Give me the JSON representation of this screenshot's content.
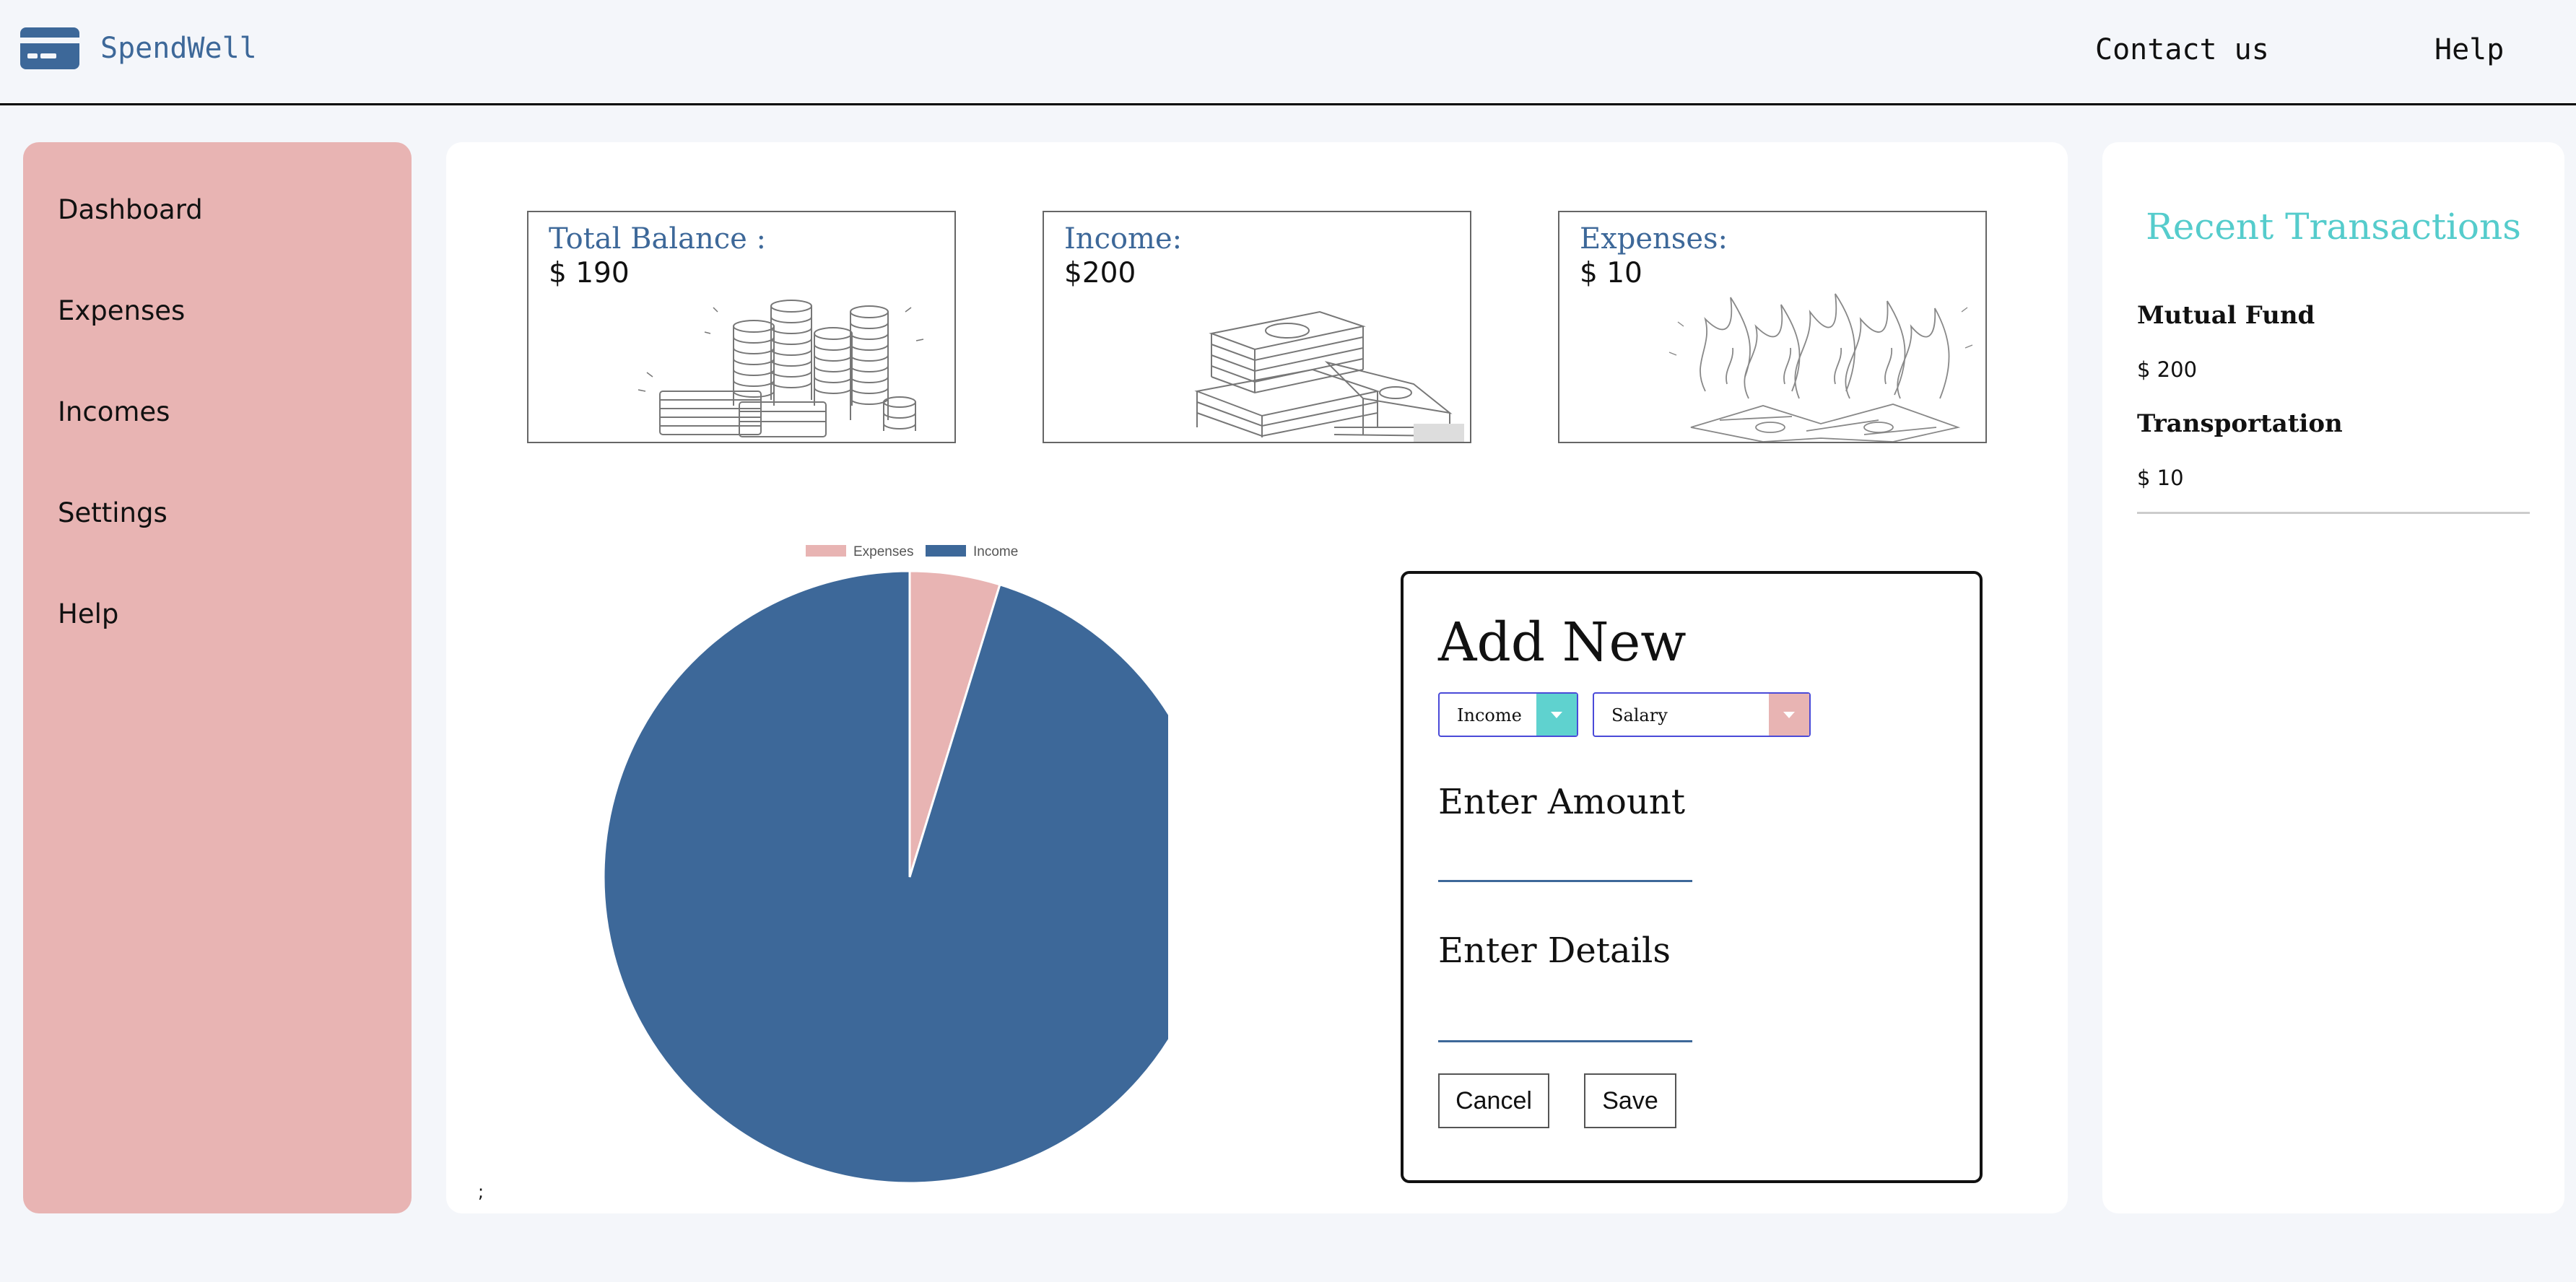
{
  "header": {
    "brand": "SpendWell",
    "logo_icon": "credit-card-icon",
    "nav": [
      {
        "label": "Contact us"
      },
      {
        "label": "Help"
      }
    ]
  },
  "sidebar": {
    "items": [
      {
        "label": "Dashboard"
      },
      {
        "label": "Expenses"
      },
      {
        "label": "Incomes"
      },
      {
        "label": "Settings"
      },
      {
        "label": "Help"
      }
    ]
  },
  "cards": [
    {
      "title": "Total Balance :",
      "value": "$ 190",
      "art_icon": "coin-stacks-icon"
    },
    {
      "title": "Income:",
      "value": "$200",
      "art_icon": "cash-stack-icon"
    },
    {
      "title": "Expenses:",
      "value": "$ 10",
      "art_icon": "burning-money-icon"
    }
  ],
  "chart_data": {
    "type": "pie",
    "categories": [
      "Expenses",
      "Income"
    ],
    "values": [
      10,
      200
    ],
    "colors": [
      "#e8b4b3",
      "#3d6899"
    ],
    "legend": "top"
  },
  "stray_text": ";",
  "add_form": {
    "title": "Add New",
    "type_select": "Income",
    "category_select": "Salary",
    "amount_label": "Enter Amount",
    "details_label": "Enter Details",
    "cancel_label": "Cancel",
    "save_label": "Save"
  },
  "recent": {
    "title": "Recent Transactions",
    "items": [
      {
        "name": "Mutual Fund",
        "amount": "$ 200"
      },
      {
        "name": "Transportation",
        "amount": "$ 10"
      }
    ]
  },
  "colors": {
    "accent_blue": "#3d6899",
    "pink": "#e8b4b3",
    "teal": "#55cccc"
  }
}
